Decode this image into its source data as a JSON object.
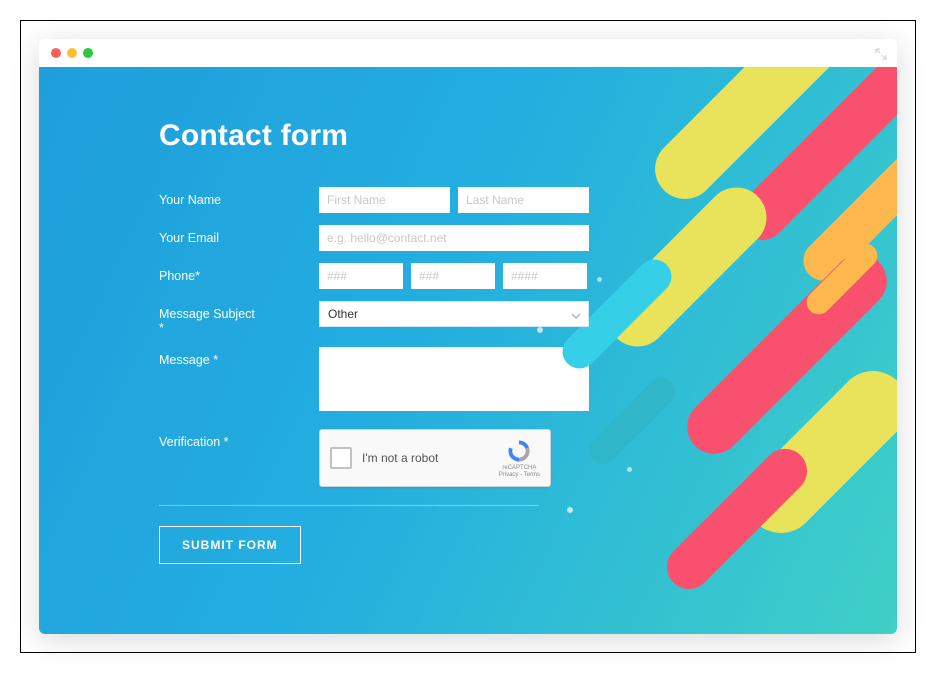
{
  "window": {
    "traffic_colors": {
      "red": "#ff5f57",
      "yellow": "#ffbd2e",
      "green": "#28c840"
    }
  },
  "page": {
    "title": "Contact form",
    "submit_label": "SUBMIT FORM"
  },
  "fields": {
    "name": {
      "label": "Your Name",
      "first_placeholder": "First Name",
      "last_placeholder": "Last Name",
      "first_value": "",
      "last_value": ""
    },
    "email": {
      "label": "Your Email",
      "placeholder": "e.g. hello@contact.net",
      "value": ""
    },
    "phone": {
      "label": "Phone*",
      "p1_placeholder": "###",
      "p2_placeholder": "###",
      "p3_placeholder": "####",
      "p1_value": "",
      "p2_value": "",
      "p3_value": ""
    },
    "subject": {
      "label": "Message Subject *",
      "selected": "Other"
    },
    "message": {
      "label": "Message *",
      "value": ""
    },
    "verification": {
      "label": "Verification *",
      "checkbox_label": "I'm not a robot",
      "brand": "reCAPTCHA",
      "terms": "Privacy - Terms"
    }
  },
  "colors": {
    "bg_gradient_from": "#1f9edb",
    "bg_gradient_to": "#40d0c7",
    "accent_yellow": "#e8e35a",
    "accent_pink": "#f9506e",
    "accent_orange": "#ffb84d",
    "accent_cyan": "#35d0e8",
    "accent_teal": "#2fb7c9"
  }
}
